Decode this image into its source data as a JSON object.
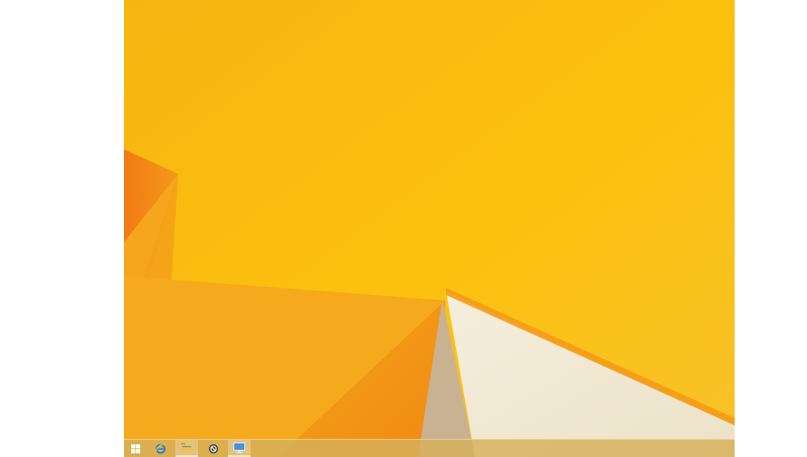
{
  "desktop": {
    "background_color": "#f7b613",
    "accent_shade": "#f08a12",
    "highlight_color": "#f1e8d4"
  },
  "taskbar": {
    "buttons": [
      {
        "name": "start-button",
        "icon": "windows-logo-icon"
      },
      {
        "name": "internet-explorer-button",
        "icon": "internet-explorer-icon"
      },
      {
        "name": "file-explorer-button",
        "icon": "folder-icon",
        "active": true
      },
      {
        "name": "app-button",
        "icon": "circle-slash-icon"
      },
      {
        "name": "remote-desktop-button",
        "icon": "monitor-icon",
        "active": true
      }
    ]
  }
}
